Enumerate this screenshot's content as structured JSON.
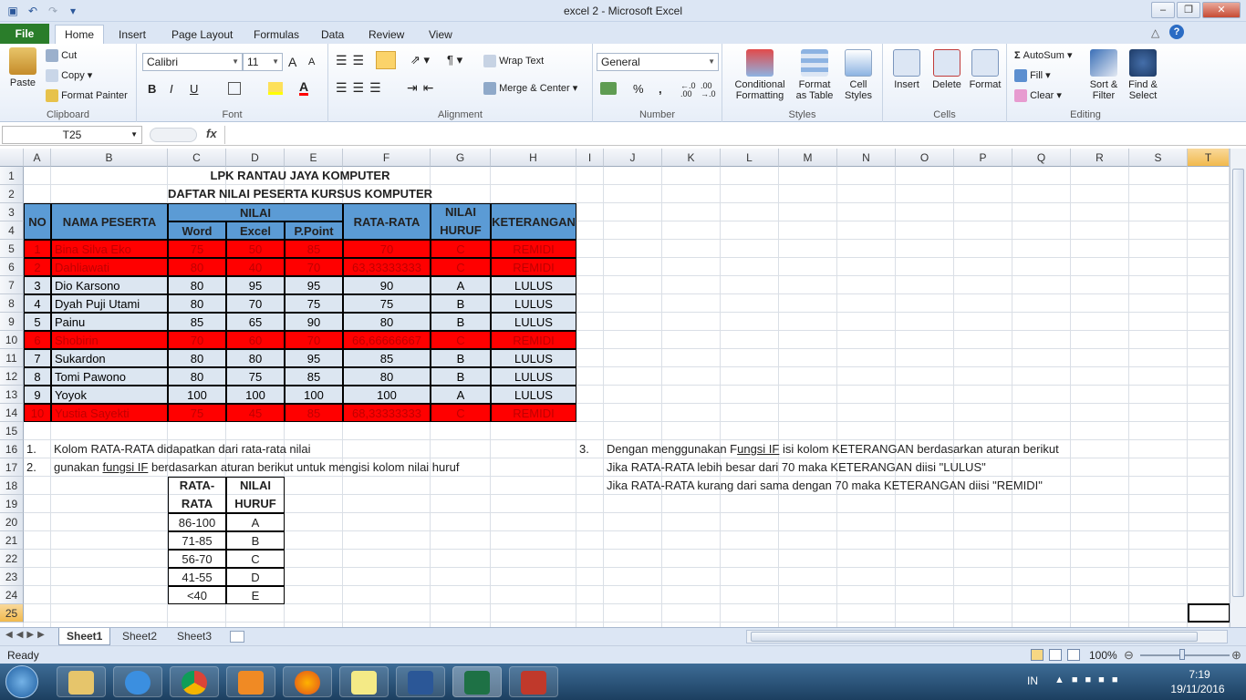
{
  "window": {
    "title": "excel 2  -  Microsoft Excel",
    "min": "–",
    "restore": "❐",
    "close": "✕"
  },
  "qat": {
    "save_icon": "▣",
    "undo_icon": "↶",
    "redo_icon": "↷",
    "customize_icon": "▾"
  },
  "tabs": [
    "File",
    "Home",
    "Insert",
    "Page Layout",
    "Formulas",
    "Data",
    "Review",
    "View"
  ],
  "ribbon": {
    "clipboard": {
      "paste": "Paste",
      "cut": "Cut",
      "copy": "Copy",
      "format_painter": "Format Painter",
      "label": "Clipboard"
    },
    "font": {
      "name": "Calibri",
      "size": "11",
      "bold": "B",
      "italic": "I",
      "underline": "U",
      "grow": "A",
      "shrink": "A",
      "font_color": "A",
      "label": "Font"
    },
    "alignment": {
      "wrap": "Wrap Text",
      "merge": "Merge & Center",
      "label": "Alignment"
    },
    "number": {
      "format": "General",
      "percent": "%",
      "comma": ",",
      "inc": "←.0 .00",
      "dec": ".00 →.0",
      "label": "Number"
    },
    "styles": {
      "conditional": "Conditional\nFormatting",
      "format_table": "Format\nas Table",
      "cell_styles": "Cell\nStyles",
      "label": "Styles"
    },
    "cells": {
      "insert": "Insert",
      "delete": "Delete",
      "format": "Format",
      "label": "Cells"
    },
    "editing": {
      "autosum": "AutoSum",
      "fill": "Fill",
      "clear": "Clear",
      "sort": "Sort &\nFilter",
      "find": "Find &\nSelect",
      "label": "Editing"
    }
  },
  "formula_bar": {
    "name_box": "T25",
    "fx": "fx",
    "value": ""
  },
  "columns": [
    "A",
    "B",
    "C",
    "D",
    "E",
    "F",
    "G",
    "H",
    "I",
    "J",
    "K",
    "L",
    "M",
    "N",
    "O",
    "P",
    "Q",
    "R",
    "S",
    "T"
  ],
  "rows": [
    "1",
    "2",
    "3",
    "4",
    "5",
    "6",
    "7",
    "8",
    "9",
    "10",
    "11",
    "12",
    "13",
    "14",
    "15",
    "16",
    "17",
    "18",
    "19",
    "20",
    "21",
    "22",
    "23",
    "24",
    "25"
  ],
  "sheet": {
    "title1": "LPK RANTAU JAYA KOMPUTER",
    "title2": "DAFTAR NILAI PESERTA KURSUS KOMPUTER",
    "headers": {
      "no": "NO",
      "nama": "NAMA PESERTA",
      "nilai": "NILAI",
      "word": "Word",
      "excel": "Excel",
      "ppoint": "P.Point",
      "rata": "RATA-RATA",
      "huruf1": "NILAI",
      "huruf2": "HURUF",
      "ket": "KETERANGAN"
    },
    "data_rows": [
      {
        "no": "1",
        "nama": "Bina Silva Eko",
        "word": "75",
        "excel": "50",
        "ppoint": "85",
        "rata": "70",
        "huruf": "C",
        "ket": "REMIDI",
        "remidi": true
      },
      {
        "no": "2",
        "nama": "Dahliawati",
        "word": "80",
        "excel": "40",
        "ppoint": "70",
        "rata": "63,33333333",
        "huruf": "C",
        "ket": "REMIDI",
        "remidi": true
      },
      {
        "no": "3",
        "nama": "Dio Karsono",
        "word": "80",
        "excel": "95",
        "ppoint": "95",
        "rata": "90",
        "huruf": "A",
        "ket": "LULUS",
        "remidi": false
      },
      {
        "no": "4",
        "nama": "Dyah Puji Utami",
        "word": "80",
        "excel": "70",
        "ppoint": "75",
        "rata": "75",
        "huruf": "B",
        "ket": "LULUS",
        "remidi": false
      },
      {
        "no": "5",
        "nama": "Painu",
        "word": "85",
        "excel": "65",
        "ppoint": "90",
        "rata": "80",
        "huruf": "B",
        "ket": "LULUS",
        "remidi": false
      },
      {
        "no": "6",
        "nama": "Shobirin",
        "word": "70",
        "excel": "60",
        "ppoint": "70",
        "rata": "66,66666667",
        "huruf": "C",
        "ket": "REMIDI",
        "remidi": true
      },
      {
        "no": "7",
        "nama": "Sukardon",
        "word": "80",
        "excel": "80",
        "ppoint": "95",
        "rata": "85",
        "huruf": "B",
        "ket": "LULUS",
        "remidi": false
      },
      {
        "no": "8",
        "nama": "Tomi Pawono",
        "word": "80",
        "excel": "75",
        "ppoint": "85",
        "rata": "80",
        "huruf": "B",
        "ket": "LULUS",
        "remidi": false
      },
      {
        "no": "9",
        "nama": "Yoyok",
        "word": "100",
        "excel": "100",
        "ppoint": "100",
        "rata": "100",
        "huruf": "A",
        "ket": "LULUS",
        "remidi": false
      },
      {
        "no": "10",
        "nama": "Yustia Sayekti",
        "word": "75",
        "excel": "45",
        "ppoint": "85",
        "rata": "68,33333333",
        "huruf": "C",
        "ket": "REMIDI",
        "remidi": true
      }
    ],
    "note1_num": "1.",
    "note1": "Kolom RATA-RATA didapatkan dari rata-rata nilai",
    "note2_num": "2.",
    "note2_a": "gunakan ",
    "note2_link": "fungsi IF",
    "note2_b": " berdasarkan aturan berikut untuk mengisi kolom nilai huruf",
    "note3_num": "3.",
    "note3_a": "Dengan menggunakan F",
    "note3_link": "ungsi IF",
    "note3_b": " isi kolom KETERANGAN berdasarkan aturan berikut",
    "note3_line2": "Jika RATA-RATA lebih besar dari 70 maka KETERANGAN diisi \"LULUS\"",
    "note3_line3": "Jika RATA-RATA kurang dari sama dengan 70 maka KETERANGAN diisi \"REMIDI\"",
    "grade_table": {
      "h1a": "RATA-",
      "h1b": "RATA",
      "h2a": "NILAI",
      "h2b": "HURUF",
      "rows": [
        {
          "range": "86-100",
          "grade": "A"
        },
        {
          "range": "71-85",
          "grade": "B"
        },
        {
          "range": "56-70",
          "grade": "C"
        },
        {
          "range": "41-55",
          "grade": "D"
        },
        {
          "range": "<40",
          "grade": "E"
        }
      ]
    }
  },
  "sheet_tabs": [
    "Sheet1",
    "Sheet2",
    "Sheet3"
  ],
  "status": {
    "ready": "Ready",
    "zoom": "100%"
  },
  "taskbar": {
    "lang": "IN",
    "time": "7:19",
    "date": "19/11/2016"
  },
  "colors": {
    "header_blue": "#5b9bd5",
    "remidi_red": "#ff0000",
    "lulus_fill": "#dce6f1",
    "remidi_text": "#c00000",
    "file_tab": "#2a7d2a"
  }
}
